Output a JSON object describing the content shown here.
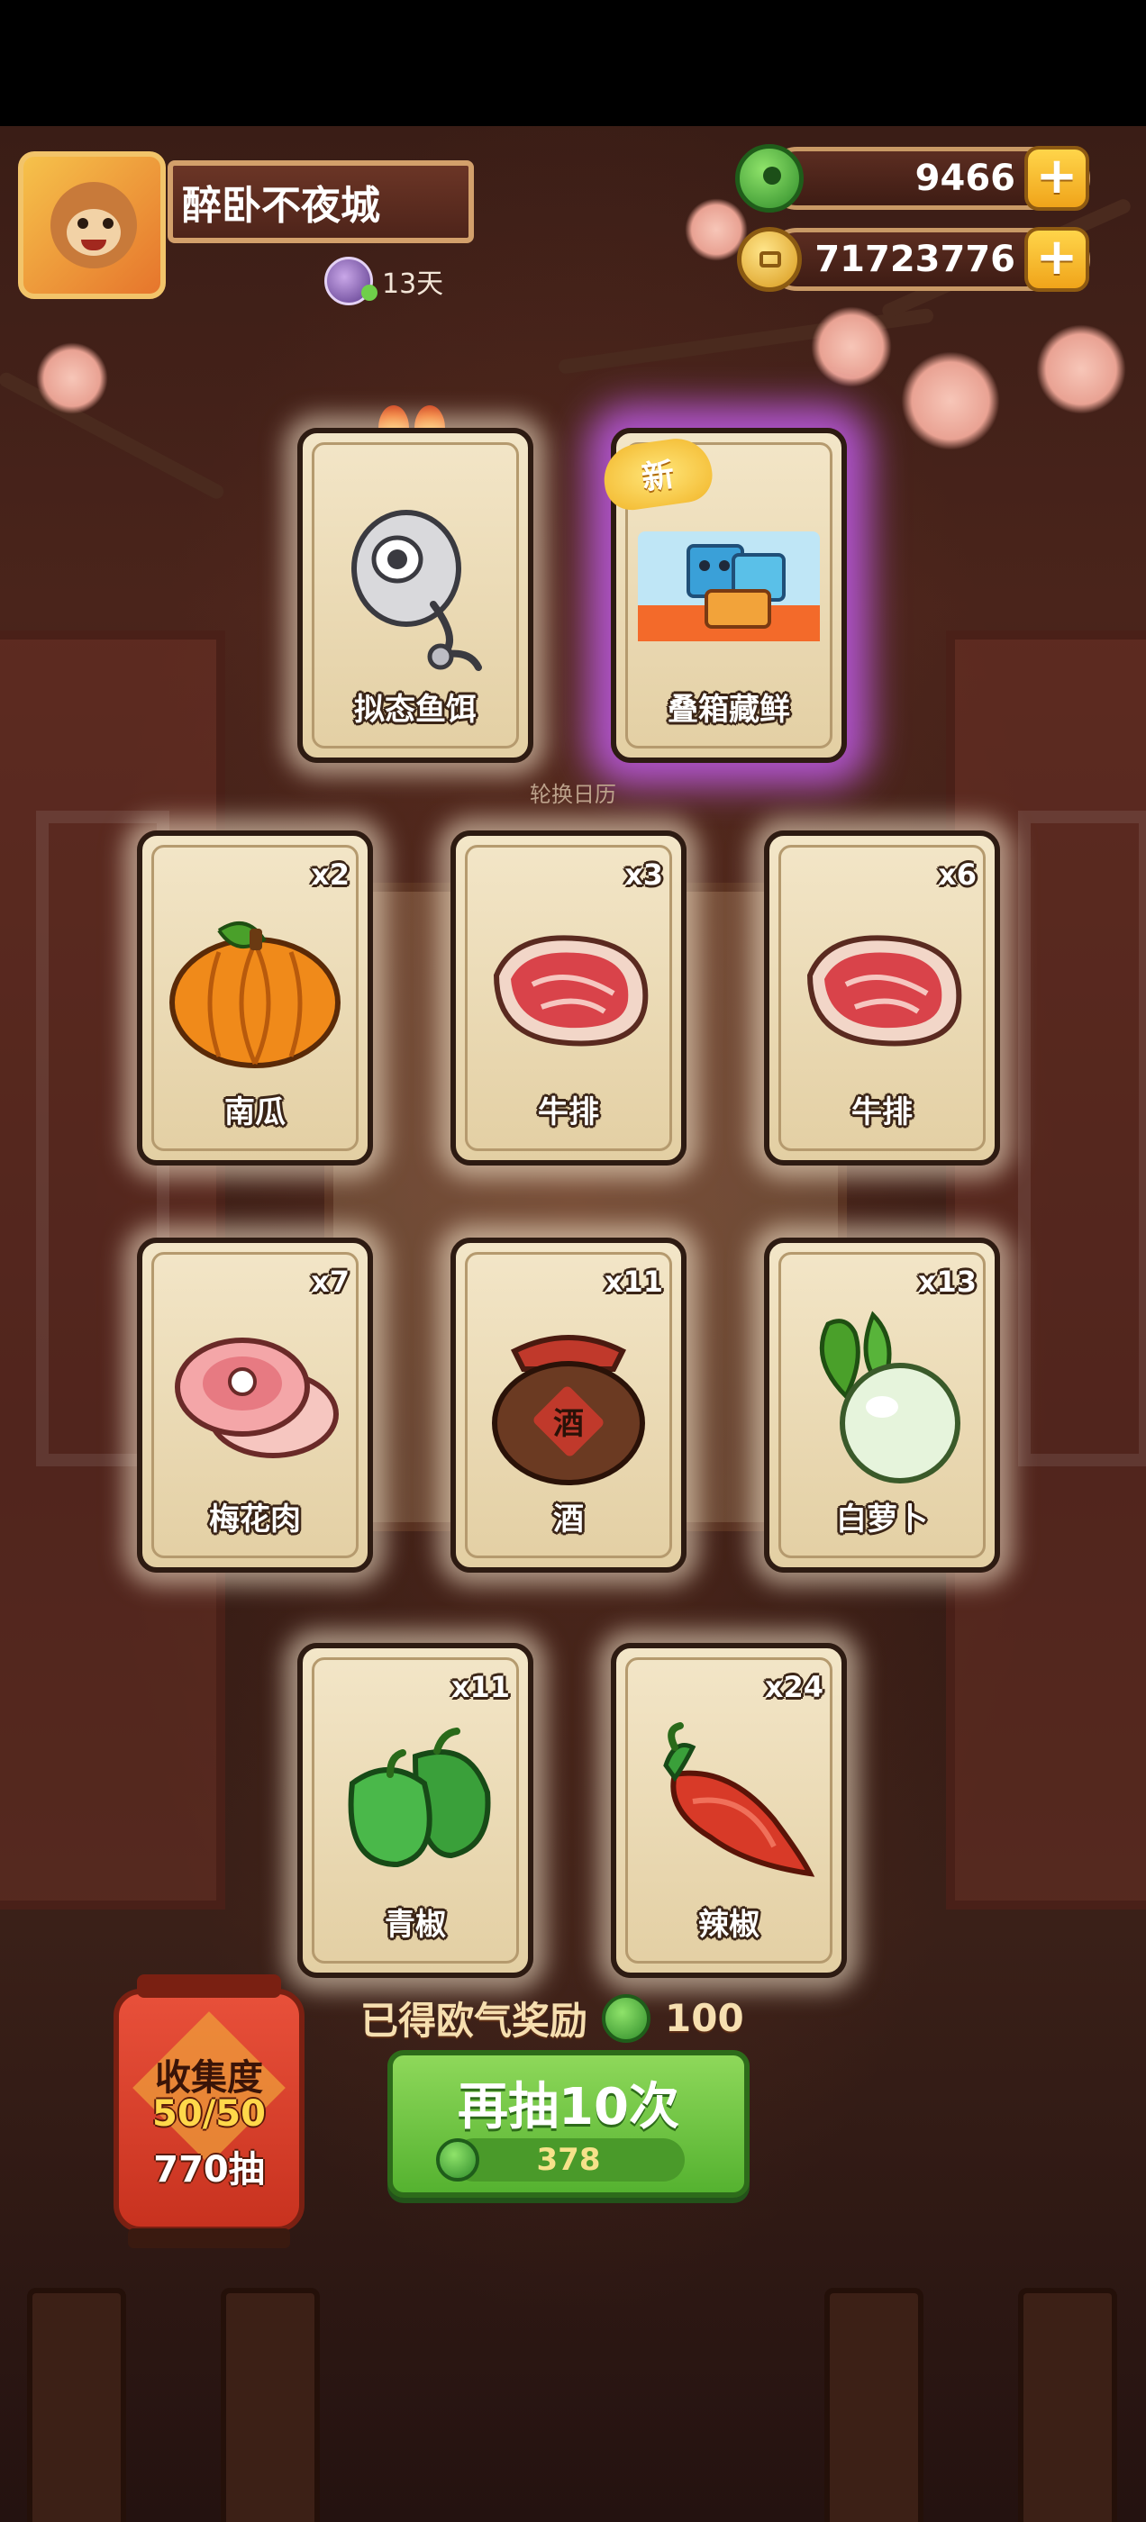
{
  "player": {
    "name": "醉卧不夜城",
    "days": "13天"
  },
  "currency": {
    "gems": "9466",
    "coins": "71723776",
    "plus": "+"
  },
  "featured": [
    {
      "label": "拟态鱼饵",
      "badge": "hot"
    },
    {
      "label": "叠箱藏鲜",
      "badge": "新"
    }
  ],
  "subtitle": "轮换日历",
  "cards": [
    {
      "label": "南瓜",
      "count": "x2",
      "icon": "pumpkin"
    },
    {
      "label": "牛排",
      "count": "x3",
      "icon": "steak"
    },
    {
      "label": "牛排",
      "count": "x6",
      "icon": "steak"
    },
    {
      "label": "梅花肉",
      "count": "x7",
      "icon": "pork"
    },
    {
      "label": "酒",
      "count": "x11",
      "icon": "wine-jar",
      "jar_text": "酒"
    },
    {
      "label": "白萝卜",
      "count": "x13",
      "icon": "radish"
    },
    {
      "label": "青椒",
      "count": "x11",
      "icon": "green-pepper"
    },
    {
      "label": "辣椒",
      "count": "x24",
      "icon": "chili"
    }
  ],
  "reward": {
    "text": "已得欧气奖励",
    "amount": "100"
  },
  "redraw": {
    "label": "再抽10次",
    "cost": "378"
  },
  "collection": {
    "title": "收集度",
    "progress": "50/50",
    "draws": "770抽"
  }
}
